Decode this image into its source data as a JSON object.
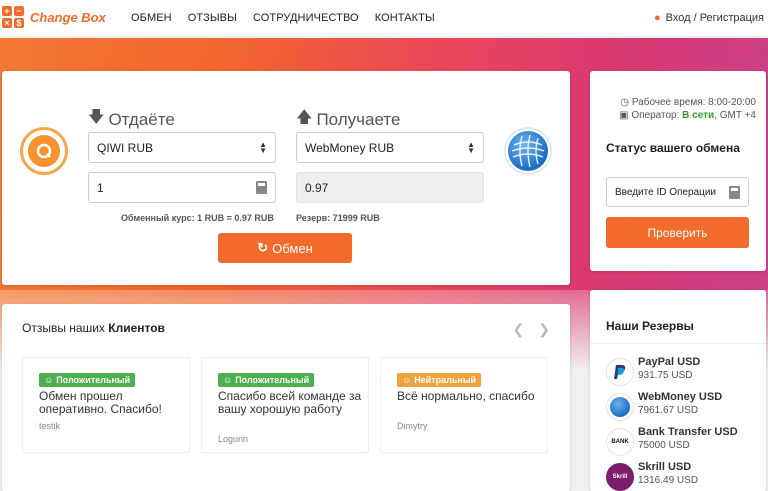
{
  "brand": {
    "name": "Change Box",
    "logo_glyphs": [
      "+",
      "−",
      "×",
      "$"
    ]
  },
  "nav": {
    "items": [
      "ОБМЕН",
      "ОТЗЫВЫ",
      "СОТРУДНИЧЕСТВО",
      "КОНТАКТЫ"
    ]
  },
  "login": {
    "icon": "user-icon",
    "label": "Вход / Регистрация"
  },
  "exchange": {
    "give_title": "Отдаёте",
    "get_title": "Получаете",
    "give_currency": "QIWI RUB",
    "get_currency": "WebMoney RUB",
    "give_amount": "1",
    "get_amount": "0.97",
    "rate": "Обменный курс: 1 RUB = 0.97 RUB",
    "reserve": "Резерв: 71999 RUB",
    "button": "Обмен"
  },
  "status_panel": {
    "work_time": "Рабочее время: 8:00-20:00",
    "operator_label": "Оператор:",
    "operator_status": "В сети",
    "operator_tz": ", GMT +4",
    "title": "Статус вашего обмена",
    "id_placeholder": "Введите ID Операции",
    "check_button": "Проверить"
  },
  "reviews": {
    "title_part1": "Отзывы наших ",
    "title_part2": "Клиентов",
    "items": [
      {
        "badge": "Положительный",
        "text": "Обмен прошел оперативно. Спасибо!",
        "author": "testik"
      },
      {
        "badge": "Положительный",
        "text": "Спасибо всей команде за вашу хорошую работу",
        "author": "Logurin"
      },
      {
        "badge": "Нейтральный",
        "text": "Всё нормально, спасибо",
        "author": "Dimytry"
      }
    ]
  },
  "reserves": {
    "title": "Наши Резервы",
    "items": [
      {
        "name": "PayPal USD",
        "amount": "931.75 USD",
        "icon": "paypal-icon"
      },
      {
        "name": "WebMoney USD",
        "amount": "7961.67 USD",
        "icon": "webmoney-icon"
      },
      {
        "name": "Bank Transfer USD",
        "amount": "75000 USD",
        "icon": "bank-icon",
        "icon_text": "BANK"
      },
      {
        "name": "Skrill USD",
        "amount": "1316.49 USD",
        "icon": "skrill-icon",
        "icon_text": "Skrill"
      }
    ]
  },
  "colors": {
    "accent": "#f26b2b",
    "positive": "#4cb050",
    "neutral": "#f0a33a",
    "online": "#2a9d2a"
  }
}
